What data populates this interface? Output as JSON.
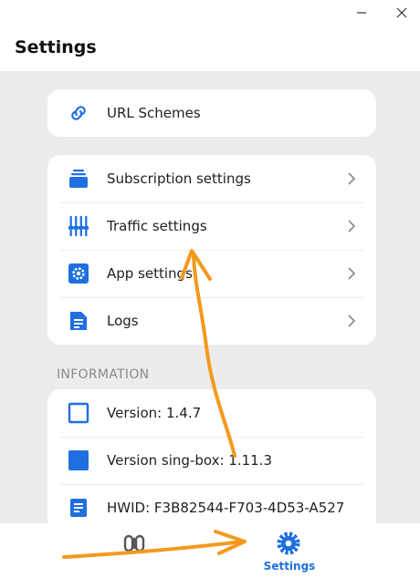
{
  "window": {
    "minimize_icon": "minimize-icon",
    "close_icon": "close-icon"
  },
  "page": {
    "title": "Settings"
  },
  "general_card": {
    "items": [
      {
        "label": "URL Schemes",
        "icon": "link-icon"
      }
    ]
  },
  "settings_card": {
    "items": [
      {
        "label": "Subscription settings",
        "icon": "stack-icon"
      },
      {
        "label": "Traffic settings",
        "icon": "equalizer-icon"
      },
      {
        "label": "App settings",
        "icon": "gear-square-icon"
      },
      {
        "label": "Logs",
        "icon": "document-icon"
      }
    ]
  },
  "information": {
    "header": "INFORMATION",
    "items": [
      {
        "label": "Version: 1.4.7",
        "icon": "square-outline-icon"
      },
      {
        "label": "Version sing-box: 1.11.3",
        "icon": "square-filled-icon"
      },
      {
        "label": "HWID: F3B82544-F703-4D53-A527",
        "icon": "document-icon"
      }
    ]
  },
  "bottom_nav": {
    "items": [
      {
        "label": "",
        "icon": "link-chain-icon",
        "active": false
      },
      {
        "label": "Settings",
        "icon": "gear-icon",
        "active": true
      }
    ]
  },
  "colors": {
    "accent": "#1f6fe0",
    "background": "#ececec",
    "card": "#ffffff",
    "annotation": "#f39a1e"
  }
}
